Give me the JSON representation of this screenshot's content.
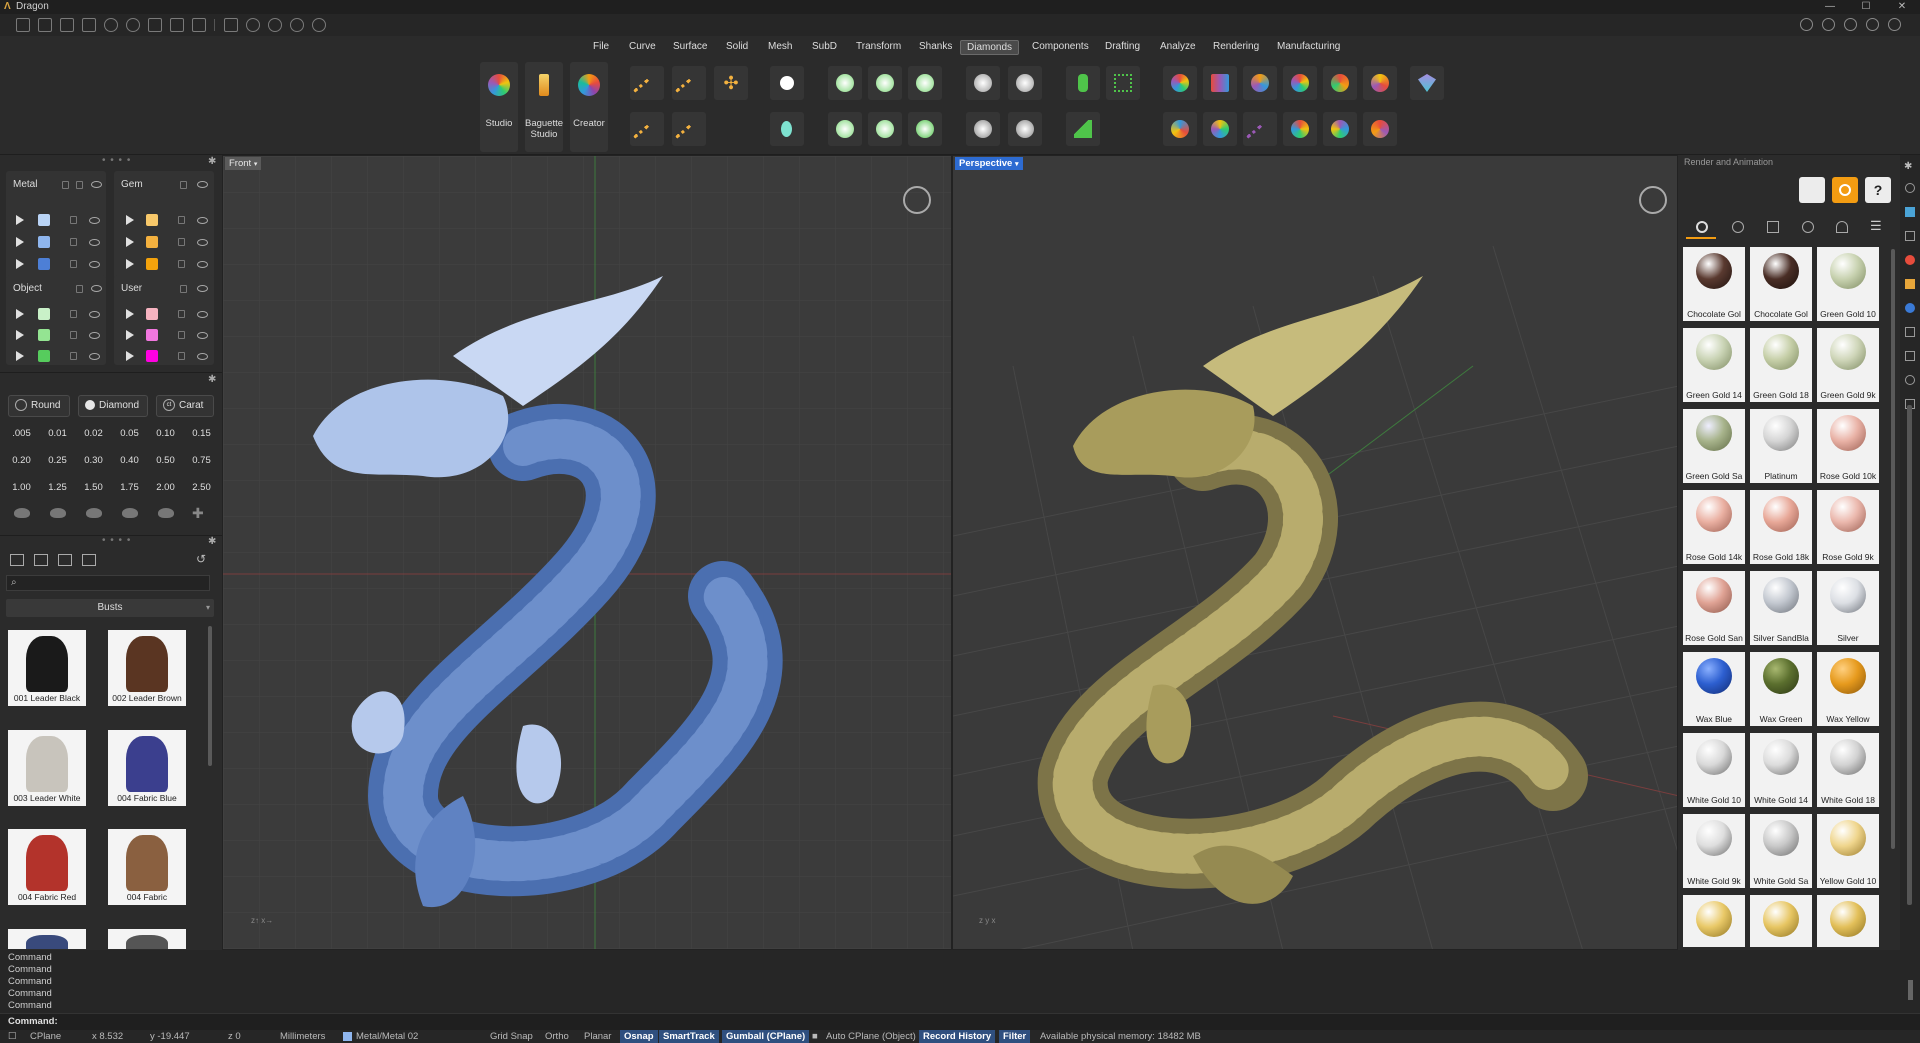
{
  "window": {
    "title": "Dragon"
  },
  "menu": {
    "items": [
      "File",
      "Curve",
      "Surface",
      "Solid",
      "Mesh",
      "SubD",
      "Transform",
      "Shanks",
      "Diamonds",
      "Components",
      "Drafting",
      "Analyze",
      "Rendering",
      "Manufacturing"
    ],
    "active": "Diamonds"
  },
  "ribbon": {
    "studio_label": "Studio",
    "baguette_label_1": "Baguette",
    "baguette_label_2": "Studio",
    "creator_label": "Creator"
  },
  "layers": {
    "groups": [
      {
        "name": "Metal",
        "colors": [
          "#b9d3f5",
          "#8fb6ee",
          "#4d7fd6"
        ]
      },
      {
        "name": "Gem",
        "colors": [
          "#f7c86a",
          "#f4b13f",
          "#f3a20c"
        ]
      },
      {
        "name": "Object",
        "colors": [
          "#c9f1c8",
          "#94e492",
          "#56cc5d"
        ]
      },
      {
        "name": "User",
        "colors": [
          "#f6b3c0",
          "#f277df",
          "#ff00e1"
        ]
      }
    ]
  },
  "gems": {
    "types": [
      "Round",
      "Diamond",
      "Carat"
    ],
    "sizes": [
      ".005",
      "0.01",
      "0.02",
      "0.05",
      "0.10",
      "0.15",
      "0.20",
      "0.25",
      "0.30",
      "0.40",
      "0.50",
      "0.75",
      "1.00",
      "1.25",
      "1.50",
      "1.75",
      "2.00",
      "2.50"
    ]
  },
  "library": {
    "category": "Busts",
    "items": [
      {
        "label": "001 Leader Black",
        "color": "#1a1a1a"
      },
      {
        "label": "002 Leader Brown",
        "color": "#5a3522"
      },
      {
        "label": "003 Leader White",
        "color": "#c8c4bc"
      },
      {
        "label": "004 Fabric Blue",
        "color": "#3b3f8e"
      },
      {
        "label": "004 Fabric Red",
        "color": "#b3332b"
      },
      {
        "label": "004 Fabric",
        "color": "#8a6040"
      }
    ]
  },
  "viewports": {
    "front": {
      "label": "Front"
    },
    "perspective": {
      "label": "Perspective"
    }
  },
  "render_panel": {
    "title": "Render and Animation",
    "help": "?",
    "materials": [
      {
        "label": "Chocolate Gol",
        "color": "#5a3a30"
      },
      {
        "label": "Chocolate Gol",
        "color": "#4a2e26"
      },
      {
        "label": "Green Gold 10",
        "color": "#c8d2b0"
      },
      {
        "label": "Green Gold 14",
        "color": "#c9d3b4"
      },
      {
        "label": "Green Gold 18",
        "color": "#c6cfa8"
      },
      {
        "label": "Green Gold 9k",
        "color": "#cfd6b9"
      },
      {
        "label": "Green Gold Sa",
        "color": "#a8b48c"
      },
      {
        "label": "Platinum",
        "color": "#d5d5d5"
      },
      {
        "label": "Rose Gold 10k",
        "color": "#e9b2a6"
      },
      {
        "label": "Rose Gold 14k",
        "color": "#eab0a2"
      },
      {
        "label": "Rose Gold 18k",
        "color": "#e8a898"
      },
      {
        "label": "Rose Gold 9k",
        "color": "#ebb8ad"
      },
      {
        "label": "Rose Gold San",
        "color": "#e0a395"
      },
      {
        "label": "Silver SandBla",
        "color": "#c3c8d0"
      },
      {
        "label": "Silver",
        "color": "#dcdfe4"
      },
      {
        "label": "Wax Blue",
        "color": "#2d5fd0"
      },
      {
        "label": "Wax Green",
        "color": "#5b6f2e"
      },
      {
        "label": "Wax Yellow",
        "color": "#e69a1d"
      },
      {
        "label": "White Gold 10",
        "color": "#d9d9d9"
      },
      {
        "label": "White Gold 14",
        "color": "#dcdcdc"
      },
      {
        "label": "White Gold 18",
        "color": "#d2d2d2"
      },
      {
        "label": "White Gold 9k",
        "color": "#dedede"
      },
      {
        "label": "White Gold Sa",
        "color": "#c9c9c9"
      },
      {
        "label": "Yellow Gold 10",
        "color": "#efd58c"
      },
      {
        "label": "",
        "color": "#e9c968"
      },
      {
        "label": "",
        "color": "#e7c663"
      },
      {
        "label": "",
        "color": "#e3c05a"
      }
    ]
  },
  "command": {
    "history": [
      "Command",
      "Command",
      "Command",
      "Command",
      "Command"
    ],
    "prompt": "Command:"
  },
  "status": {
    "cplane": "CPlane",
    "x": "x 8.532",
    "y": "y -19.447",
    "z": "z 0",
    "units": "Millimeters",
    "layer": "Metal/Metal 02",
    "grid_snap": "Grid Snap",
    "ortho": "Ortho",
    "planar": "Planar",
    "osnap": "Osnap",
    "smarttrack": "SmartTrack",
    "gumball": "Gumball (CPlane)",
    "auto_cplane": "Auto CPlane (Object)",
    "record_history": "Record History",
    "filter": "Filter",
    "memory": "Available physical memory: 18482 MB"
  }
}
